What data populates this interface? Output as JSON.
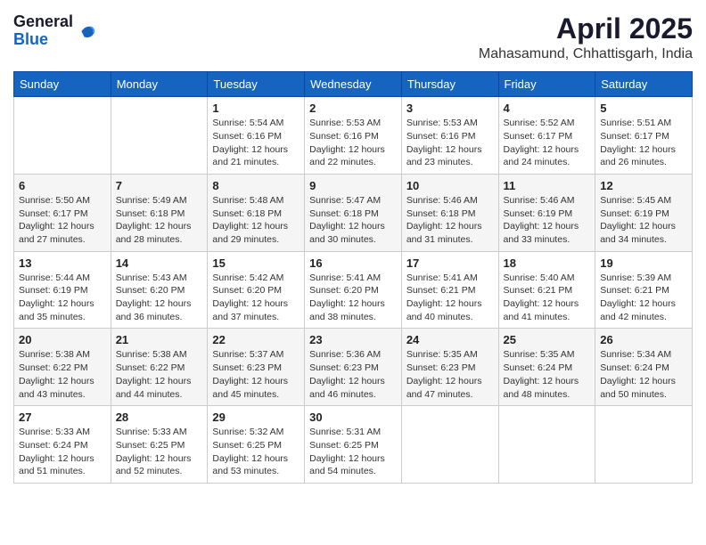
{
  "header": {
    "logo_general": "General",
    "logo_blue": "Blue",
    "month_title": "April 2025",
    "location": "Mahasamund, Chhattisgarh, India"
  },
  "days_of_week": [
    "Sunday",
    "Monday",
    "Tuesday",
    "Wednesday",
    "Thursday",
    "Friday",
    "Saturday"
  ],
  "weeks": [
    [
      {
        "day": "",
        "info": ""
      },
      {
        "day": "",
        "info": ""
      },
      {
        "day": "1",
        "info": "Sunrise: 5:54 AM\nSunset: 6:16 PM\nDaylight: 12 hours and 21 minutes."
      },
      {
        "day": "2",
        "info": "Sunrise: 5:53 AM\nSunset: 6:16 PM\nDaylight: 12 hours and 22 minutes."
      },
      {
        "day": "3",
        "info": "Sunrise: 5:53 AM\nSunset: 6:16 PM\nDaylight: 12 hours and 23 minutes."
      },
      {
        "day": "4",
        "info": "Sunrise: 5:52 AM\nSunset: 6:17 PM\nDaylight: 12 hours and 24 minutes."
      },
      {
        "day": "5",
        "info": "Sunrise: 5:51 AM\nSunset: 6:17 PM\nDaylight: 12 hours and 26 minutes."
      }
    ],
    [
      {
        "day": "6",
        "info": "Sunrise: 5:50 AM\nSunset: 6:17 PM\nDaylight: 12 hours and 27 minutes."
      },
      {
        "day": "7",
        "info": "Sunrise: 5:49 AM\nSunset: 6:18 PM\nDaylight: 12 hours and 28 minutes."
      },
      {
        "day": "8",
        "info": "Sunrise: 5:48 AM\nSunset: 6:18 PM\nDaylight: 12 hours and 29 minutes."
      },
      {
        "day": "9",
        "info": "Sunrise: 5:47 AM\nSunset: 6:18 PM\nDaylight: 12 hours and 30 minutes."
      },
      {
        "day": "10",
        "info": "Sunrise: 5:46 AM\nSunset: 6:18 PM\nDaylight: 12 hours and 31 minutes."
      },
      {
        "day": "11",
        "info": "Sunrise: 5:46 AM\nSunset: 6:19 PM\nDaylight: 12 hours and 33 minutes."
      },
      {
        "day": "12",
        "info": "Sunrise: 5:45 AM\nSunset: 6:19 PM\nDaylight: 12 hours and 34 minutes."
      }
    ],
    [
      {
        "day": "13",
        "info": "Sunrise: 5:44 AM\nSunset: 6:19 PM\nDaylight: 12 hours and 35 minutes."
      },
      {
        "day": "14",
        "info": "Sunrise: 5:43 AM\nSunset: 6:20 PM\nDaylight: 12 hours and 36 minutes."
      },
      {
        "day": "15",
        "info": "Sunrise: 5:42 AM\nSunset: 6:20 PM\nDaylight: 12 hours and 37 minutes."
      },
      {
        "day": "16",
        "info": "Sunrise: 5:41 AM\nSunset: 6:20 PM\nDaylight: 12 hours and 38 minutes."
      },
      {
        "day": "17",
        "info": "Sunrise: 5:41 AM\nSunset: 6:21 PM\nDaylight: 12 hours and 40 minutes."
      },
      {
        "day": "18",
        "info": "Sunrise: 5:40 AM\nSunset: 6:21 PM\nDaylight: 12 hours and 41 minutes."
      },
      {
        "day": "19",
        "info": "Sunrise: 5:39 AM\nSunset: 6:21 PM\nDaylight: 12 hours and 42 minutes."
      }
    ],
    [
      {
        "day": "20",
        "info": "Sunrise: 5:38 AM\nSunset: 6:22 PM\nDaylight: 12 hours and 43 minutes."
      },
      {
        "day": "21",
        "info": "Sunrise: 5:38 AM\nSunset: 6:22 PM\nDaylight: 12 hours and 44 minutes."
      },
      {
        "day": "22",
        "info": "Sunrise: 5:37 AM\nSunset: 6:23 PM\nDaylight: 12 hours and 45 minutes."
      },
      {
        "day": "23",
        "info": "Sunrise: 5:36 AM\nSunset: 6:23 PM\nDaylight: 12 hours and 46 minutes."
      },
      {
        "day": "24",
        "info": "Sunrise: 5:35 AM\nSunset: 6:23 PM\nDaylight: 12 hours and 47 minutes."
      },
      {
        "day": "25",
        "info": "Sunrise: 5:35 AM\nSunset: 6:24 PM\nDaylight: 12 hours and 48 minutes."
      },
      {
        "day": "26",
        "info": "Sunrise: 5:34 AM\nSunset: 6:24 PM\nDaylight: 12 hours and 50 minutes."
      }
    ],
    [
      {
        "day": "27",
        "info": "Sunrise: 5:33 AM\nSunset: 6:24 PM\nDaylight: 12 hours and 51 minutes."
      },
      {
        "day": "28",
        "info": "Sunrise: 5:33 AM\nSunset: 6:25 PM\nDaylight: 12 hours and 52 minutes."
      },
      {
        "day": "29",
        "info": "Sunrise: 5:32 AM\nSunset: 6:25 PM\nDaylight: 12 hours and 53 minutes."
      },
      {
        "day": "30",
        "info": "Sunrise: 5:31 AM\nSunset: 6:25 PM\nDaylight: 12 hours and 54 minutes."
      },
      {
        "day": "",
        "info": ""
      },
      {
        "day": "",
        "info": ""
      },
      {
        "day": "",
        "info": ""
      }
    ]
  ]
}
